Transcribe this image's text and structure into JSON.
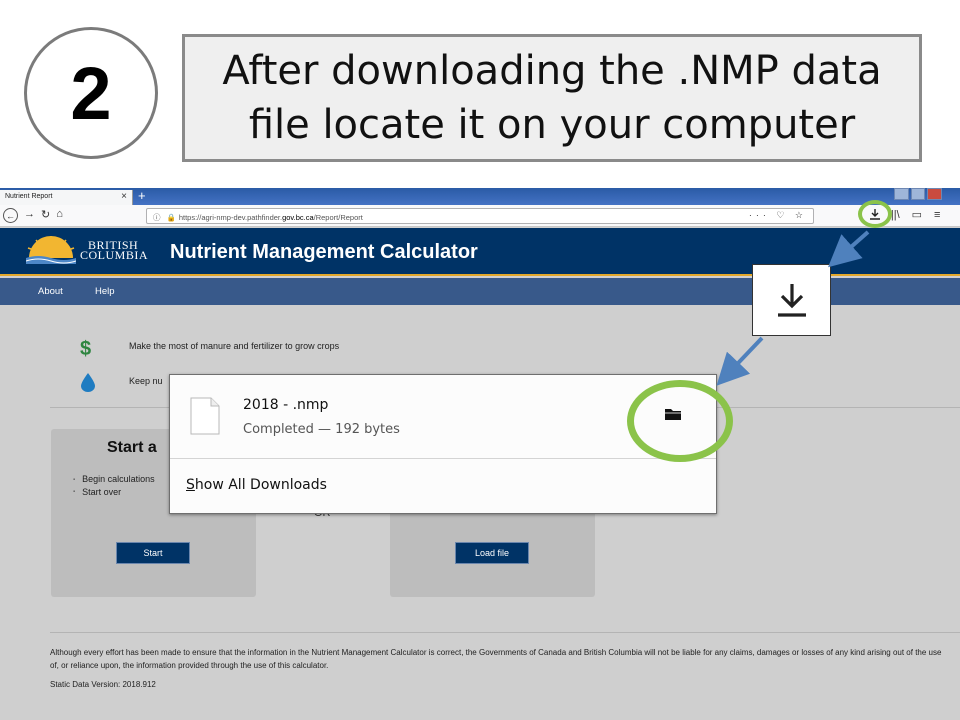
{
  "slide": {
    "step_number": "2",
    "instruction": "After downloading the .NMP data file locate it on your computer"
  },
  "browser": {
    "tab_title": "Nutrient Report",
    "tab_close": "×",
    "new_tab": "+",
    "url_prefix": "https://agri-nmp-dev.pathfinder.",
    "url_host": "gov.bc.ca",
    "url_path": "/Report/Report",
    "url_actions": "··· ♡ ☆",
    "download_icon": "download-icon"
  },
  "app": {
    "logo_line1": "BRITISH",
    "logo_line2": "COLUMBIA",
    "title": "Nutrient Management Calculator",
    "nav": [
      "About",
      "Help"
    ],
    "tagline1": "Make the most of manure and fertilizer to grow crops",
    "tagline2": "Keep nu",
    "card1": {
      "title": "Start a",
      "items": [
        "Begin calculations",
        "Start over"
      ],
      "button": "Start"
    },
    "or_text": "OR",
    "card2": {
      "button": "Load file"
    },
    "disclaimer": "Although every effort has been made to ensure that the information in the Nutrient Management Calculator is correct, the Governments of Canada and British Columbia will not be liable for any claims, damages or losses of any kind arising out of the use of, or reliance upon, the information provided through the use of this calculator.",
    "static_version": "Static Data Version: 2018.912"
  },
  "downloads_panel": {
    "file_name": "2018 -       .nmp",
    "status": "Completed — 192 bytes",
    "show_all_first": "S",
    "show_all_rest": "how All Downloads"
  },
  "colors": {
    "highlight_ring": "#8bc34a",
    "callout_arrow": "#4f81bd",
    "header_bg": "#003366",
    "nav_bg": "#38598a"
  }
}
